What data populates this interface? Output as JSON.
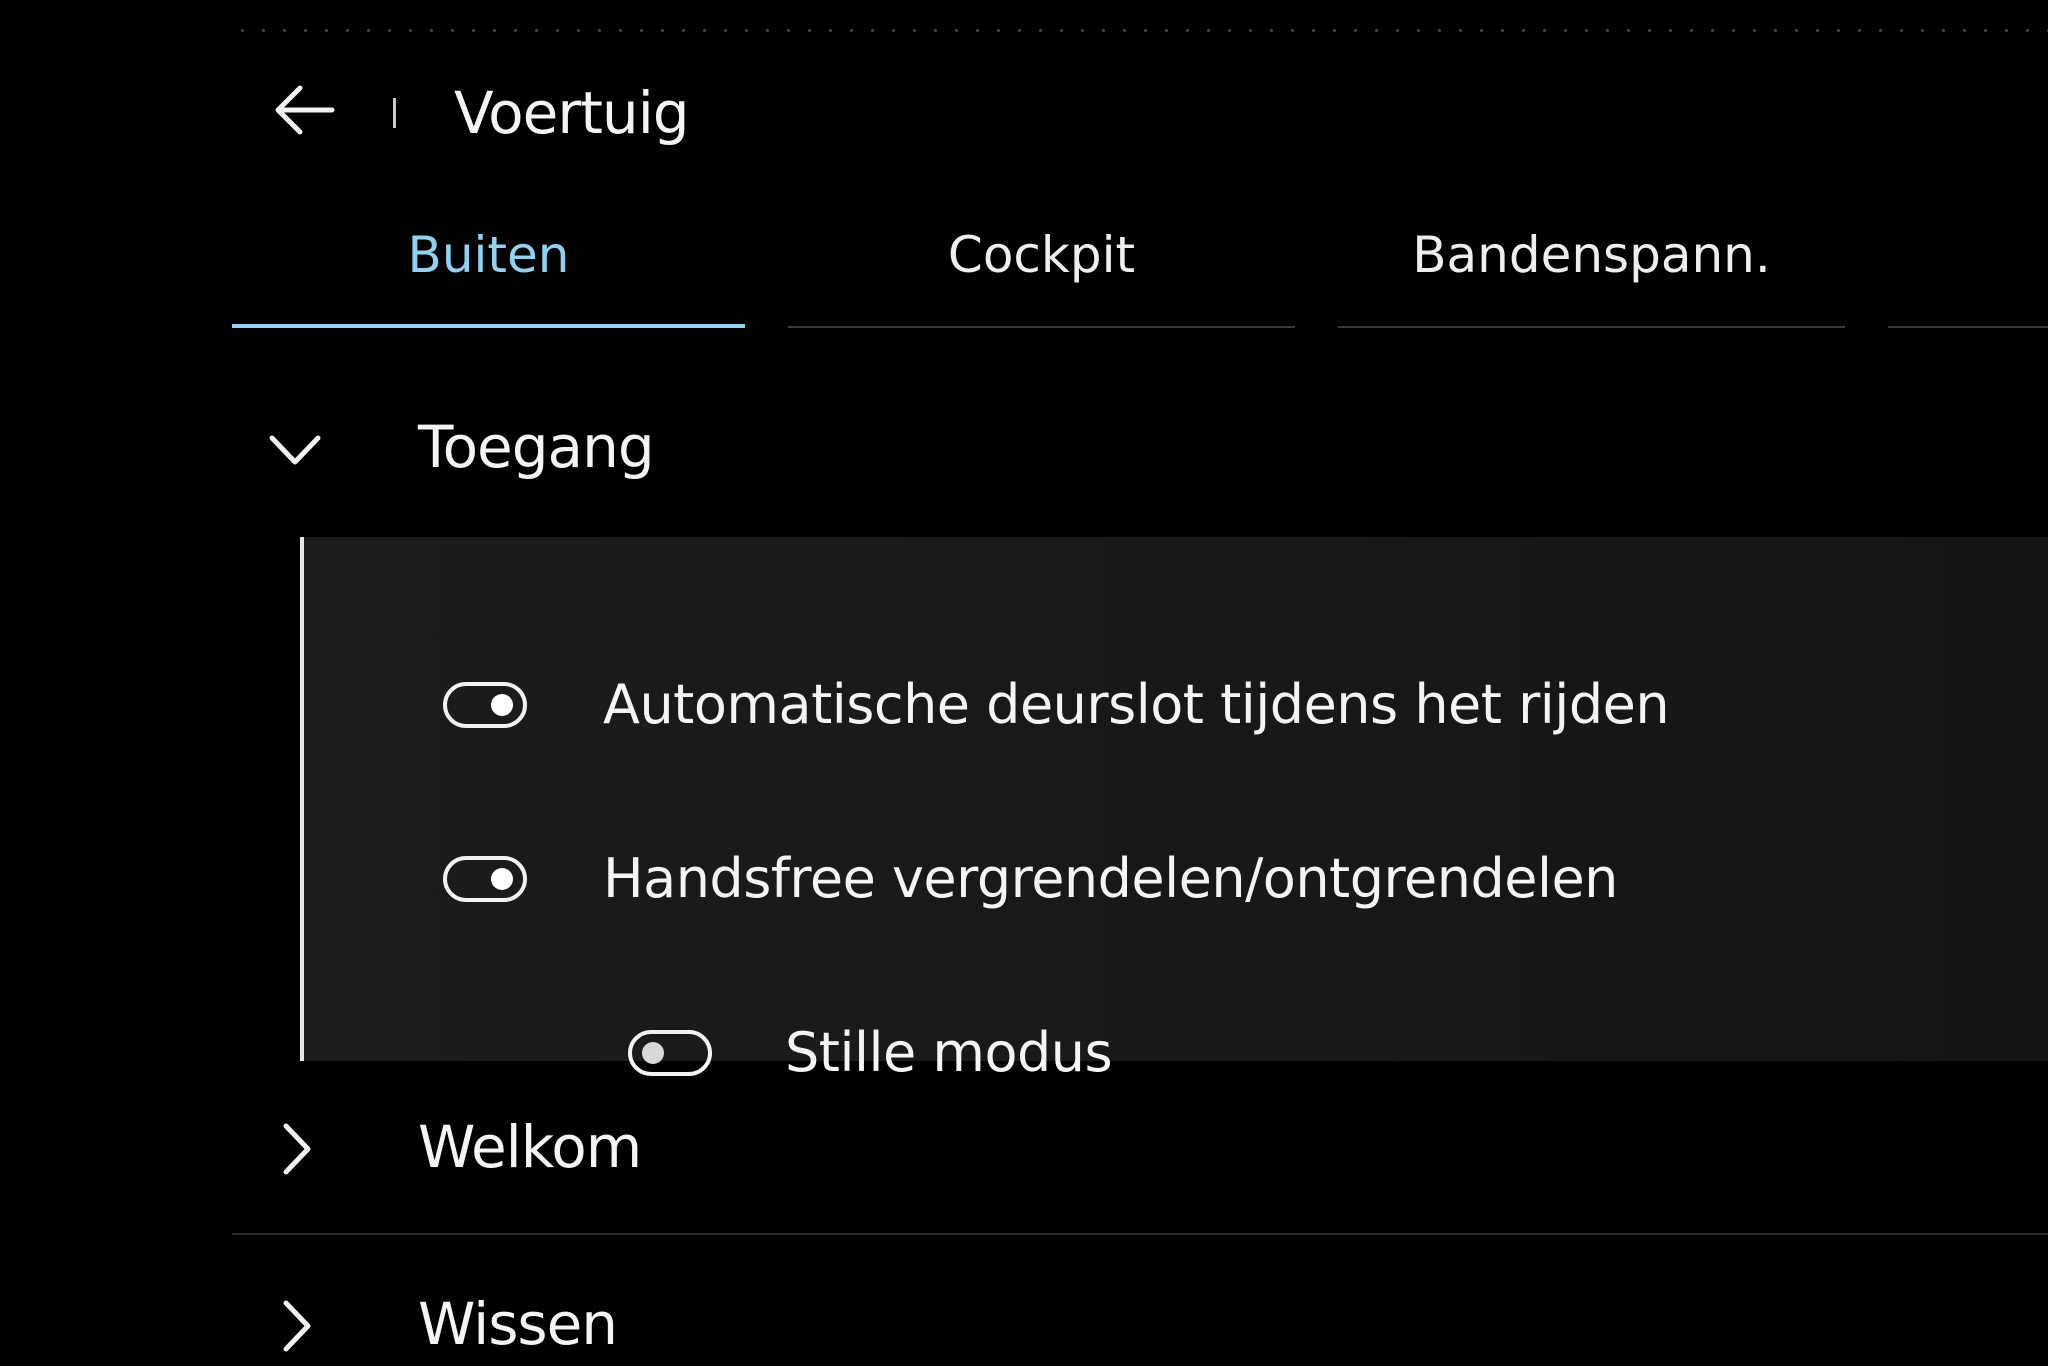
{
  "header": {
    "title": "Voertuig",
    "back_icon": "arrow-left-icon"
  },
  "tabs": [
    {
      "label": "Buiten",
      "active": true
    },
    {
      "label": "Cockpit",
      "active": false
    },
    {
      "label": "Bandenspann.",
      "active": false
    }
  ],
  "sections": {
    "toegang": {
      "label": "Toegang",
      "expanded": true,
      "icon": "chevron-down-icon",
      "items": [
        {
          "label": "Automatische deurslot tijdens het rijden",
          "enabled": true
        },
        {
          "label": "Handsfree vergrendelen/ontgrendelen",
          "enabled": true
        },
        {
          "label": "Stille modus",
          "enabled": false
        }
      ]
    },
    "welkom": {
      "label": "Welkom",
      "expanded": false,
      "icon": "chevron-right-icon"
    },
    "wissen": {
      "label": "Wissen",
      "expanded": false,
      "icon": "chevron-right-icon"
    }
  },
  "colors": {
    "accent": "#8ed3f2",
    "background": "#000000",
    "panel": "#1a1a1a",
    "text": "#f4f4f4"
  }
}
